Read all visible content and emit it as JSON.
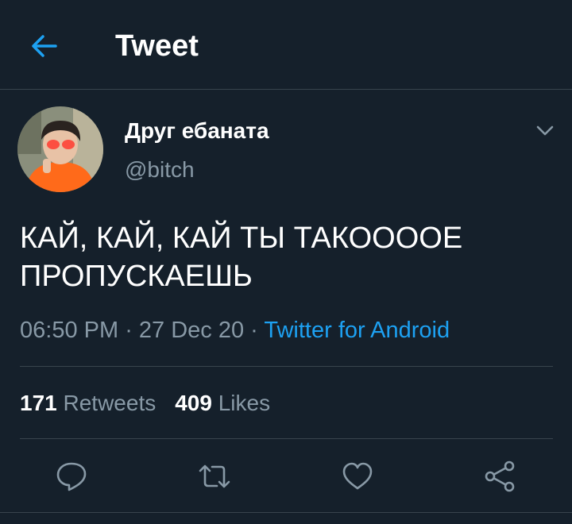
{
  "header": {
    "title": "Tweet",
    "back_icon": "arrow-left-icon"
  },
  "tweet": {
    "author": {
      "display_name": "Друг ебаната",
      "handle": "@bitch",
      "avatar": "avatar-photo"
    },
    "text_line1": "КАЙ, КАЙ, КАЙ ТЫ ТАКООООЕ",
    "text_line2": "ПРОПУСКАЕШЬ",
    "time": "06:50 PM",
    "date": "27 Dec 20",
    "separator": " · ",
    "source": "Twitter for Android"
  },
  "stats": {
    "retweets_count": "171",
    "retweets_label": "Retweets",
    "likes_count": "409",
    "likes_label": "Likes"
  },
  "actions": [
    "reply-icon",
    "retweet-icon",
    "like-icon",
    "share-icon"
  ],
  "colors": {
    "background": "#15202b",
    "accent": "#1da1f2",
    "secondary_text": "#8899a6",
    "divider": "#38444d"
  }
}
